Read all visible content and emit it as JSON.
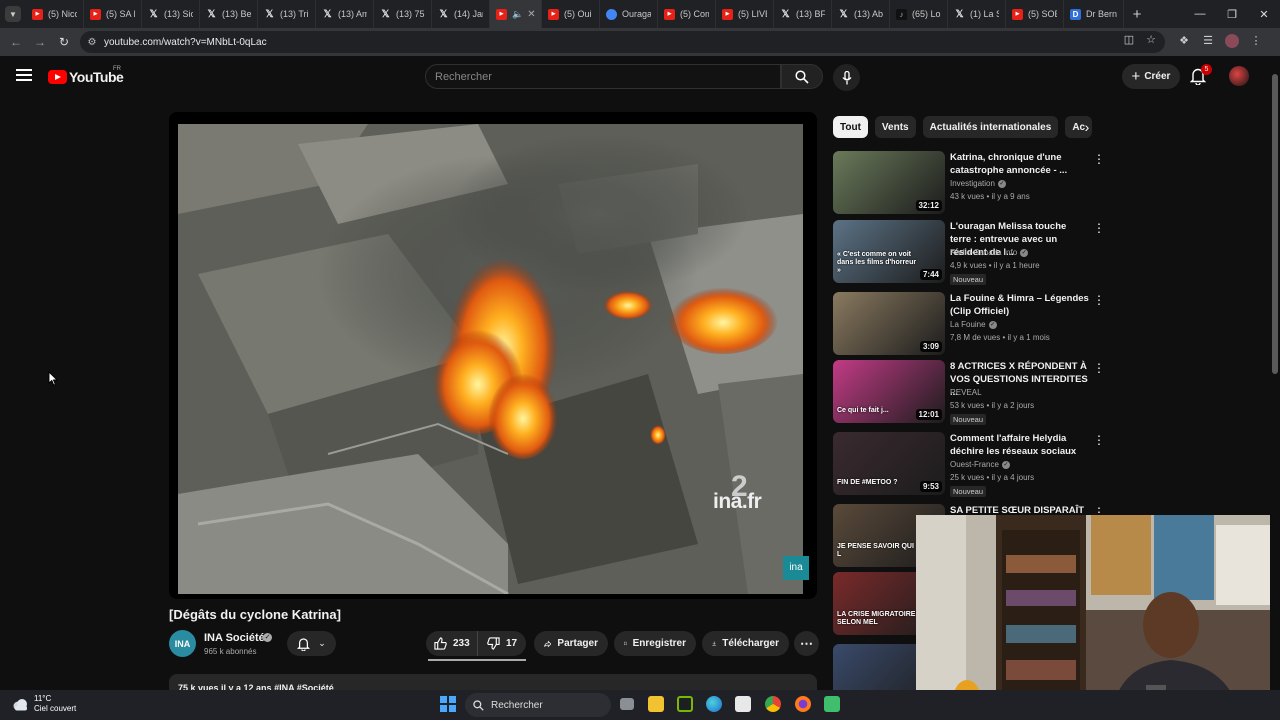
{
  "browser": {
    "tabs": [
      {
        "icon": "youtube-icon",
        "title": "(5) Nico"
      },
      {
        "icon": "youtube-icon",
        "title": "(5) SA P"
      },
      {
        "icon": "x-icon",
        "title": "(13) Sic"
      },
      {
        "icon": "x-icon",
        "title": "(13) Bel"
      },
      {
        "icon": "x-icon",
        "title": "(13) Trib"
      },
      {
        "icon": "x-icon",
        "title": "(13) Am"
      },
      {
        "icon": "x-icon",
        "title": "(13) 75"
      },
      {
        "icon": "x-icon",
        "title": "(14) Jan"
      },
      {
        "icon": "youtube-icon",
        "title": "",
        "active": true,
        "audio": true
      },
      {
        "icon": "youtube-icon",
        "title": "(5) Oui"
      },
      {
        "icon": "globe-icon",
        "title": "Ouraga"
      },
      {
        "icon": "youtube-icon",
        "title": "(5) Com"
      },
      {
        "icon": "youtube-icon",
        "title": "(5) LIVE"
      },
      {
        "icon": "x-icon",
        "title": "(13) BF"
      },
      {
        "icon": "x-icon",
        "title": "(13) Ab"
      },
      {
        "icon": "tiktok-icon",
        "title": "(65) Lou"
      },
      {
        "icon": "x-icon",
        "title": "(1) La S"
      },
      {
        "icon": "youtube-icon",
        "title": "(5) SOB"
      },
      {
        "icon": "doc-icon",
        "title": "Dr Bern"
      }
    ],
    "url": "youtube.com/watch?v=MNbLt-0qLac"
  },
  "youtube": {
    "logo_text": "YouTube",
    "country": "FR",
    "search_placeholder": "Rechercher",
    "create_label": "Créer",
    "notification_count": "5"
  },
  "video": {
    "title": "[Dégâts du cyclone Katrina]",
    "watermark": "ina.fr",
    "watermark_channel_number": "2",
    "corner_logo": "ina",
    "channel": {
      "name": "INA Société",
      "avatar_text": "INA",
      "subscribers": "965 k abonnés"
    },
    "likes": "233",
    "dislikes": "17",
    "share_label": "Partager",
    "save_label": "Enregistrer",
    "download_label": "Télécharger",
    "description_meta": "75 k vues  il y a 12 ans  #INA  #Société"
  },
  "chips": [
    "Tout",
    "Vents",
    "Actualités internationales",
    "Ac"
  ],
  "recommendations": [
    {
      "title": "Katrina, chronique d'une catastrophe annoncée - ...",
      "channel": "Investigation",
      "verified": true,
      "views": "43 k vues",
      "age": "il y a 9 ans",
      "duration": "32:12",
      "badge": "",
      "thumb_color": "#6a7a5a"
    },
    {
      "title": "L'ouragan Melissa touche terre : entrevue avec un résident de l...",
      "channel": "Radio-Canada Info",
      "verified": true,
      "views": "4,9 k vues",
      "age": "il y a 1 heure",
      "duration": "7:44",
      "badge": "Nouveau",
      "thumb_color": "#5c7386",
      "thumb_caption": "« C'est comme on voit dans les films d'horreur »"
    },
    {
      "title": "La Fouine & Himra – Légendes (Clip Officiel)",
      "channel": "La Fouine",
      "verified": true,
      "views": "7,8 M de vues",
      "age": "il y a 1 mois",
      "duration": "3:09",
      "badge": "",
      "thumb_color": "#8a7a60"
    },
    {
      "title": "8 ACTRICES X RÉPONDENT À VOS QUESTIONS INTERDITES ...",
      "channel": "REVEAL",
      "verified": false,
      "views": "53 k vues",
      "age": "il y a 2 jours",
      "duration": "12:01",
      "badge": "Nouveau",
      "thumb_color": "#c23b86",
      "thumb_caption": "Ce qui te fait j..."
    },
    {
      "title": "Comment l'affaire Helydia déchire les réseaux sociaux",
      "channel": "Ouest-France",
      "verified": true,
      "views": "25 k vues",
      "age": "il y a 4 jours",
      "duration": "9:53",
      "badge": "Nouveau",
      "thumb_color": "#3a2a30",
      "thumb_caption": "FIN DE #METOO ?"
    },
    {
      "title": "SA PETITE SŒUR DISPARAÎT",
      "channel": "",
      "verified": false,
      "views": "",
      "age": "",
      "duration": "",
      "badge": "",
      "thumb_color": "#5a4a3a",
      "thumb_caption": "JE PENSE SAVOIR QUI L"
    },
    {
      "title": "",
      "channel": "",
      "verified": false,
      "views": "",
      "age": "",
      "duration": "",
      "badge": "",
      "thumb_color": "#7a2a2a",
      "thumb_caption": "LA CRISE MIGRATOIRE SELON MEL"
    },
    {
      "title": "",
      "channel": "",
      "verified": false,
      "views": "",
      "age": "",
      "duration": "",
      "badge": "",
      "thumb_color": "#3a4a6a"
    }
  ],
  "taskbar": {
    "temperature": "11°C",
    "weather": "Ciel couvert",
    "search_label": "Rechercher"
  }
}
